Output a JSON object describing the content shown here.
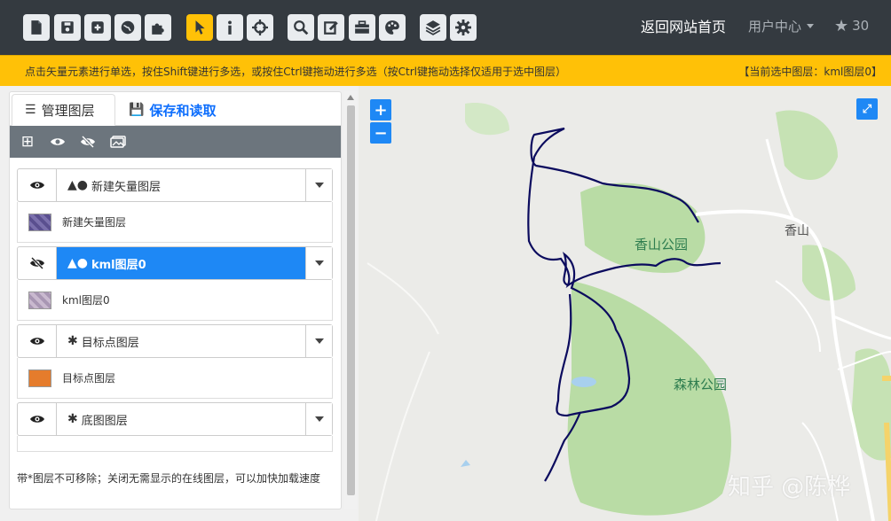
{
  "toolbar": {
    "buttons": [
      {
        "name": "new-file-icon"
      },
      {
        "name": "save-icon"
      },
      {
        "name": "add-layer-icon"
      },
      {
        "name": "globe-icon"
      },
      {
        "name": "plugin-icon"
      },
      {
        "name": "pointer-icon",
        "active": true
      },
      {
        "name": "info-icon"
      },
      {
        "name": "crosshair-icon"
      },
      {
        "name": "zoom-search-icon"
      },
      {
        "name": "edit-icon"
      },
      {
        "name": "toolbox-icon"
      },
      {
        "name": "palette-icon"
      },
      {
        "name": "layers-icon"
      },
      {
        "name": "settings-icon"
      }
    ],
    "home_link": "返回网站首页",
    "user_center": "用户中心",
    "star_count": "30"
  },
  "hint": {
    "text": "点击矢量元素进行单选，按住Shift键进行多选，或按住Ctrl键拖动进行多选（按Ctrl键拖动选择仅适用于选中图层）",
    "current_layer": "【当前选中图层：kml图层0】"
  },
  "panel": {
    "tab_manage": "管理图层",
    "tab_save": "保存和读取",
    "layers": [
      {
        "name": "新建矢量图层",
        "legend": "新建矢量图层",
        "visible": true,
        "selected": false,
        "type_icon": "vector-layer-icon",
        "swatch": "purple"
      },
      {
        "name": "kml图层0",
        "legend": "kml图层0",
        "visible": false,
        "selected": true,
        "type_icon": "vector-layer-icon",
        "swatch": "pink"
      },
      {
        "name": "目标点图层",
        "legend": "目标点图层",
        "visible": true,
        "selected": false,
        "type_icon": "asterisk-icon",
        "swatch": "orange"
      },
      {
        "name": "底图图层",
        "legend": "",
        "visible": true,
        "selected": false,
        "type_icon": "asterisk-icon",
        "swatch": ""
      }
    ],
    "footer": "带*图层不可移除；关闭无需显示的在线图层，可以加快加载速度"
  },
  "map": {
    "zoom_in": "+",
    "zoom_out": "−",
    "labels": {
      "park1": "香山公园",
      "park2": "森林公园",
      "town": "香山"
    },
    "watermark": "知乎 @陈桦",
    "track_color": "#0b0b5e"
  }
}
